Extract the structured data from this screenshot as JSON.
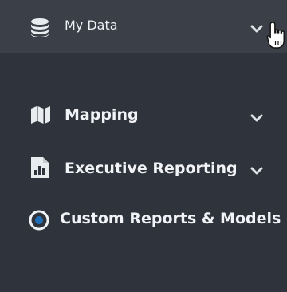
{
  "menu": {
    "items": [
      {
        "label": "My Data",
        "icon": "database-icon",
        "expanded_indicator": "chevron-down-icon",
        "hovered": true
      },
      {
        "label": "Mapping",
        "icon": "map-icon",
        "expanded_indicator": "chevron-down-icon"
      },
      {
        "label": "Executive Reporting",
        "icon": "report-chart-icon",
        "expanded_indicator": "chevron-down-icon"
      },
      {
        "label": "Custom Reports & Models",
        "icon": "radio-selected-icon",
        "selected": true
      }
    ]
  },
  "colors": {
    "background": "#2f333b",
    "hover_background": "#3a3f48",
    "text": "#f1f3f6",
    "icon": "#e9ecef"
  },
  "cursor": "hand-pointer-icon"
}
